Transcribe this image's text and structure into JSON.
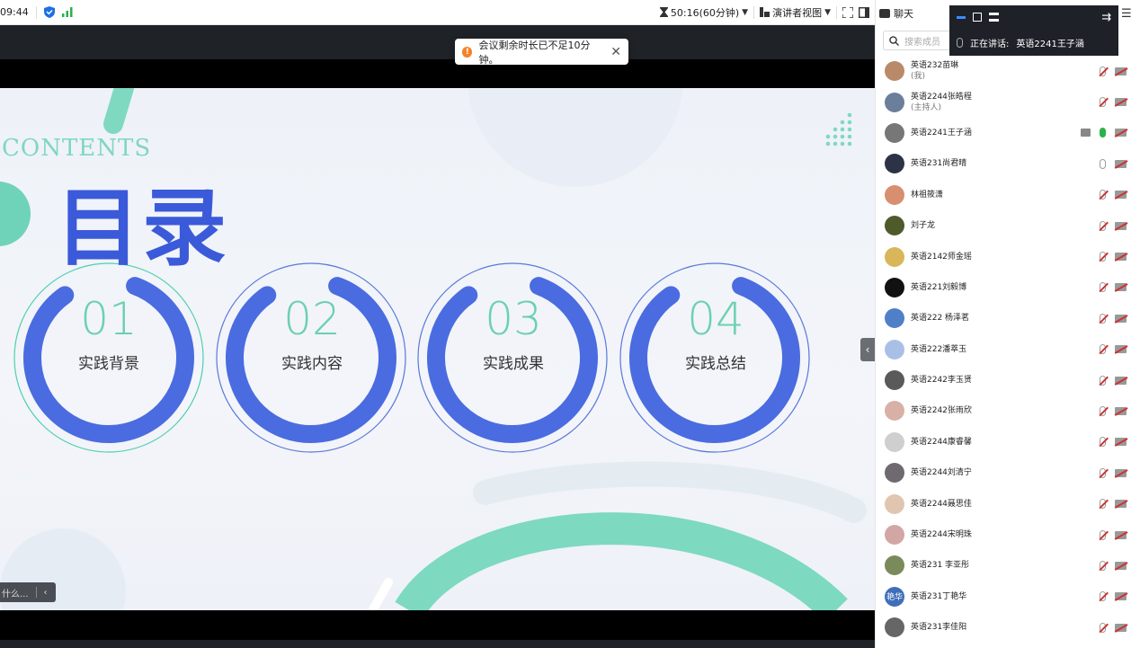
{
  "topbar": {
    "time": "09:44",
    "timer": "50:16(60分钟)",
    "view_mode": "演讲者视图"
  },
  "toast": {
    "message": "会议剩余时长已不足10分钟。"
  },
  "slide": {
    "contents_label": "CONTENTS",
    "title": "目录",
    "items": [
      {
        "num": "01",
        "label": "实践背景"
      },
      {
        "num": "02",
        "label": "实践内容"
      },
      {
        "num": "03",
        "label": "实践成果"
      },
      {
        "num": "04",
        "label": "实践总结"
      }
    ]
  },
  "left_tab": {
    "text": "什么..."
  },
  "panel": {
    "title": "聊天",
    "search_placeholder": "搜索成员",
    "speaking_label": "正在讲话:",
    "speaking_name": "英语2241王子涵"
  },
  "members": [
    {
      "name": "英语232苗琳",
      "tag": "(我)",
      "color": "#b98a6a"
    },
    {
      "name": "英语2244张皓程",
      "tag": "(主持人)",
      "color": "#6b7e9a"
    },
    {
      "name": "英语2241王子涵",
      "tag": "",
      "color": "#777777",
      "mic": "on",
      "screen": true
    },
    {
      "name": "英语231尚君晴",
      "tag": "",
      "color": "#2d3346",
      "mic": "plain"
    },
    {
      "name": "林祖筱潇",
      "tag": "",
      "color": "#d88f6f"
    },
    {
      "name": "刘子龙",
      "tag": "",
      "color": "#4e5a2c"
    },
    {
      "name": "英语2142师金瑶",
      "tag": "",
      "color": "#d9b65a"
    },
    {
      "name": "英语221刘毅博",
      "tag": "",
      "color": "#111111"
    },
    {
      "name": "英语222 杨泽茗",
      "tag": "",
      "color": "#4f7fc7"
    },
    {
      "name": "英语222潘萃玉",
      "tag": "",
      "color": "#a9c0e6"
    },
    {
      "name": "英语2242李玉贤",
      "tag": "",
      "color": "#5a5a5a"
    },
    {
      "name": "英语2242张雨欣",
      "tag": "",
      "color": "#d9b0a6"
    },
    {
      "name": "英语2244康睿馨",
      "tag": "",
      "color": "#cfcfcf"
    },
    {
      "name": "英语2244刘清宁",
      "tag": "",
      "color": "#6f6a70"
    },
    {
      "name": "英语2244聂思佳",
      "tag": "",
      "color": "#e0c6b0"
    },
    {
      "name": "英语2244宋明珠",
      "tag": "",
      "color": "#d3a6a6"
    },
    {
      "name": "英语231 李亚彤",
      "tag": "",
      "color": "#7b8a5a"
    },
    {
      "name": "英语231丁艳华",
      "tag": "",
      "color": "#3f6fb8",
      "initials": "艳华"
    },
    {
      "name": "英语231李佳阳",
      "tag": "",
      "color": "#666666"
    }
  ],
  "colors": {
    "accent": "#3a5ad9",
    "teal": "#6bd0b0",
    "toast_warn": "#f5822a"
  }
}
